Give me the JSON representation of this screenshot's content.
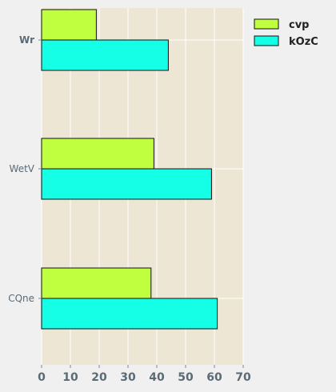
{
  "chart_data": {
    "type": "bar",
    "orientation": "horizontal",
    "categories": [
      "Wr",
      "WetV",
      "CQne"
    ],
    "series": [
      {
        "name": "cvp",
        "values": [
          19,
          39,
          38
        ],
        "color": "#bfff3f"
      },
      {
        "name": "kOzC",
        "values": [
          44,
          59,
          61
        ],
        "color": "#14ffe6"
      }
    ],
    "title": "",
    "xlabel": "",
    "ylabel": "",
    "xlim": [
      0,
      70
    ],
    "xticks": [
      "0",
      "10",
      "20",
      "30",
      "40",
      "50",
      "60",
      "70"
    ],
    "grid": true,
    "legend_position": "top-right",
    "plot_background": "#ede6d4",
    "gridline_color": "#ffffff"
  }
}
